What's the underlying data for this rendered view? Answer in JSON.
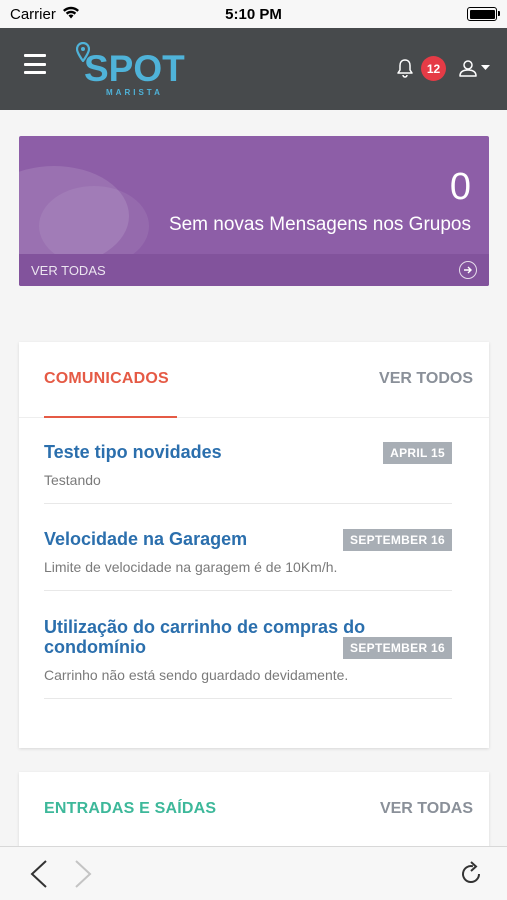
{
  "status_bar": {
    "carrier": "Carrier",
    "time": "5:10 PM",
    "battery_level": 1.0
  },
  "navbar": {
    "logo_text": "SPOT",
    "logo_subtitle": "MARISTA",
    "notifications_count": "12",
    "colors": {
      "background": "#474a4c",
      "logo": "#4fb3d9",
      "badge": "#e53b46"
    }
  },
  "messages_card": {
    "count": "0",
    "label": "Sem novas Mensagens nos Grupos",
    "footer_label": "VER TODAS",
    "color": "#8d5ea7"
  },
  "comunicados": {
    "title": "COMUNICADOS",
    "see_all": "VER TODOS",
    "items": [
      {
        "title": "Teste tipo novidades",
        "date": "APRIL 15",
        "description": "Testando"
      },
      {
        "title": "Velocidade na Garagem",
        "date": "SEPTEMBER 16",
        "description": "Limite de velocidade na garagem é de 10Km/h."
      },
      {
        "title": "Utilização do carrinho de compras do condomínio",
        "date": "SEPTEMBER 16",
        "description": "Carrinho não está sendo guardado devidamente."
      }
    ]
  },
  "entradas": {
    "title": "ENTRADAS E SAÍDAS",
    "see_all": "VER TODAS"
  }
}
